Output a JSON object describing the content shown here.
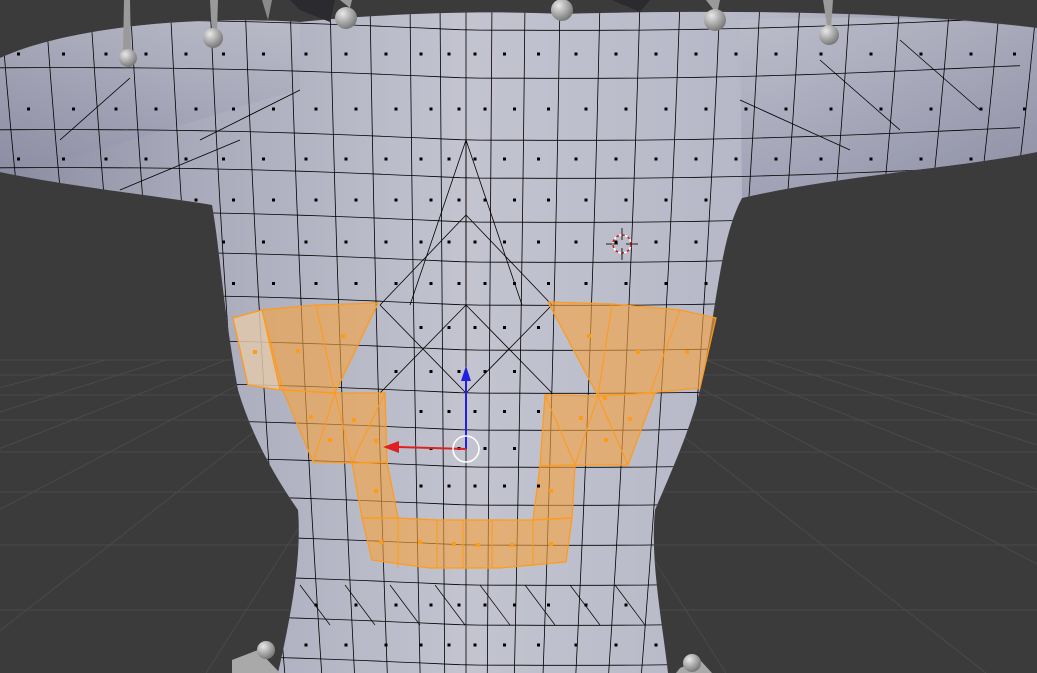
{
  "viewport": {
    "mode": "edit-mode-face-select",
    "background_color": "#3b3b3b",
    "grid_color": "#4a4a4a",
    "mesh_color": "#b9bac8",
    "mesh_shadow_color": "#7e7f92",
    "wire_color": "#000000",
    "face_dot_color": "#000000",
    "selection_color": "#f5a341",
    "selection_edge_color": "#ff9a1a",
    "active_face_color": "#d9d9d9",
    "gizmo_x_color": "#e02020",
    "gizmo_z_color": "#2020e0",
    "cursor_color": "#cc2222",
    "bones_color": "#8c8c8c"
  },
  "icons": [
    "3d-cursor-icon",
    "transform-manipulator-icon",
    "bone-joint-icon"
  ]
}
